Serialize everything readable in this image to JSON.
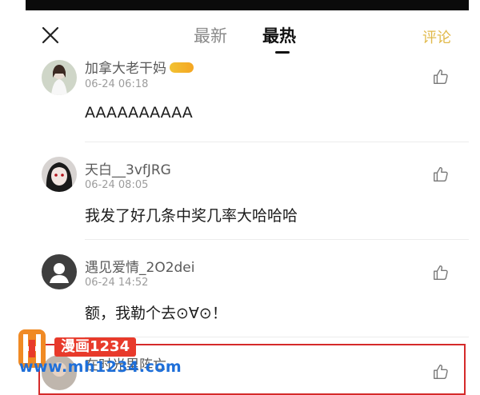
{
  "header": {
    "tabs": [
      {
        "label": "最新"
      },
      {
        "label": "最热"
      }
    ],
    "comment_action": "评论",
    "accent_color": "#e0b94a"
  },
  "comments": [
    {
      "username": "加拿大老干妈",
      "badge": "vip",
      "time": "06-24 06:18",
      "text": "AAAAAAAAAA",
      "avatar": "girl-white-avatar"
    },
    {
      "username": "天白__3vfJRG",
      "time": "06-24 08:05",
      "text": "我发了好几条中奖几率大哈哈哈",
      "avatar": "dark-hair-anime-avatar"
    },
    {
      "username": "遇见爱情_2O2dei",
      "time": "06-24 14:52",
      "text": "额，我勒个去⊙∀⊙！",
      "avatar": "default-person-avatar"
    },
    {
      "username": "在时光里阵亡",
      "time": "",
      "text": "",
      "avatar": "portrait-avatar"
    }
  ],
  "watermark": {
    "title": "漫画1234",
    "url": "www.mh1234.com"
  }
}
